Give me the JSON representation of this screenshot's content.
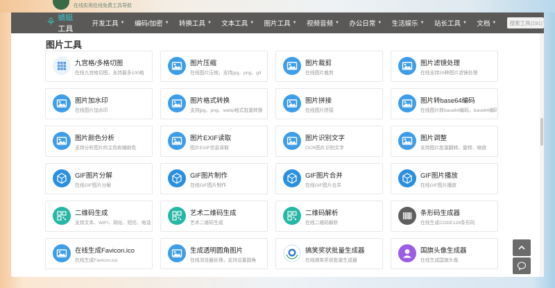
{
  "header": {
    "tagline": "在线实用在线免费工具导航",
    "brand_name_a": "蜻蜓",
    "brand_name_b": "工具"
  },
  "nav": {
    "items": [
      {
        "label": "开发工具",
        "has_dropdown": true
      },
      {
        "label": "编码/加密",
        "has_dropdown": true
      },
      {
        "label": "转换工具",
        "has_dropdown": true
      },
      {
        "label": "文本工具",
        "has_dropdown": true
      },
      {
        "label": "图片工具",
        "has_dropdown": true
      },
      {
        "label": "视频音频",
        "has_dropdown": true
      },
      {
        "label": "办公日常",
        "has_dropdown": true
      },
      {
        "label": "生活娱乐",
        "has_dropdown": true
      },
      {
        "label": "站长工具",
        "has_dropdown": true
      },
      {
        "label": "文档",
        "has_dropdown": true
      }
    ],
    "search_placeholder": "搜索工具(191)"
  },
  "section": {
    "title": "图片工具"
  },
  "tools": [
    {
      "title": "九宫格/多格切图",
      "desc": "在线九宫格切图，支持最多100格",
      "icon": "grid-icon",
      "color": "#eaf2fc"
    },
    {
      "title": "图片压缩",
      "desc": "在线图片压缩，支持jpg、png、gif",
      "icon": "image-icon",
      "color": "#3d9de8"
    },
    {
      "title": "图片裁剪",
      "desc": "在线图片裁剪",
      "icon": "image-icon",
      "color": "#3d9de8"
    },
    {
      "title": "图片滤镜处理",
      "desc": "在线支持25种图片滤镜处理",
      "icon": "image-icon",
      "color": "#3d9de8"
    },
    {
      "title": "图片加水印",
      "desc": "在线图片加水印",
      "icon": "image-icon",
      "color": "#3d9de8"
    },
    {
      "title": "图片格式转换",
      "desc": "支持jpg、png、webp格式批量转换",
      "icon": "image-icon",
      "color": "#3d9de8"
    },
    {
      "title": "图片拼接",
      "desc": "在线图片拼接",
      "icon": "image-icon",
      "color": "#3d9de8"
    },
    {
      "title": "图片转base64编码",
      "desc": "在线图片转base64编码，base64编码",
      "icon": "image-icon",
      "color": "#3d9de8"
    },
    {
      "title": "图片颜色分析",
      "desc": "支持分析图片的主色和辅助色",
      "icon": "image-icon",
      "color": "#3d9de8"
    },
    {
      "title": "图片EXIF读取",
      "desc": "图片EXIF信息读取",
      "icon": "image-icon",
      "color": "#3d9de8"
    },
    {
      "title": "图片识别文字",
      "desc": "OCR图片识别文字",
      "icon": "image-icon",
      "color": "#3d9de8"
    },
    {
      "title": "图片调整",
      "desc": "支持图片批量翻转、旋转、缩放",
      "icon": "image-icon",
      "color": "#3d9de8"
    },
    {
      "title": "GIF图片分解",
      "desc": "在线GIF图片分解",
      "icon": "gif-cube-icon",
      "color": "#2b8fe0"
    },
    {
      "title": "GIF图片制作",
      "desc": "在线GIF图片制作",
      "icon": "gif-cube-icon",
      "color": "#2b8fe0"
    },
    {
      "title": "GIF图片合并",
      "desc": "在线GIF图片合并",
      "icon": "gif-cube-icon",
      "color": "#2b8fe0"
    },
    {
      "title": "GIF图片播放",
      "desc": "在线GIF图片播放",
      "icon": "gif-cube-icon",
      "color": "#2b8fe0"
    },
    {
      "title": "二维码生成",
      "desc": "支持文本、WIFI、网址、短信、电话",
      "icon": "qrcode-icon",
      "color": "#27b7a6"
    },
    {
      "title": "艺术二维码生成",
      "desc": "艺术二维码生成",
      "icon": "qrcode-icon",
      "color": "#27b7a6"
    },
    {
      "title": "二维码解析",
      "desc": "在线二维码解析",
      "icon": "qrcode-icon",
      "color": "#27b7a6"
    },
    {
      "title": "条形码生成器",
      "desc": "在线生成CODE128条形码",
      "icon": "barcode-icon",
      "color": "#5f5f5f"
    },
    {
      "title": "在线生成Favicon.ico",
      "desc": "在线生成Favicon.ico",
      "icon": "image-icon",
      "color": "#3d9de8"
    },
    {
      "title": "生成透明圆角图片",
      "desc": "在线浏览器处理，支持设置圆角",
      "icon": "image-icon",
      "color": "#3d9de8"
    },
    {
      "title": "搞笑奖状批量生成器",
      "desc": "在线搞笑奖状批量生成器",
      "icon": "award-icon",
      "color": "#ffffff"
    },
    {
      "title": "国旗头像生成器",
      "desc": "在线生成国旗头像",
      "icon": "avatar-icon",
      "color": "#9b5de5"
    }
  ]
}
